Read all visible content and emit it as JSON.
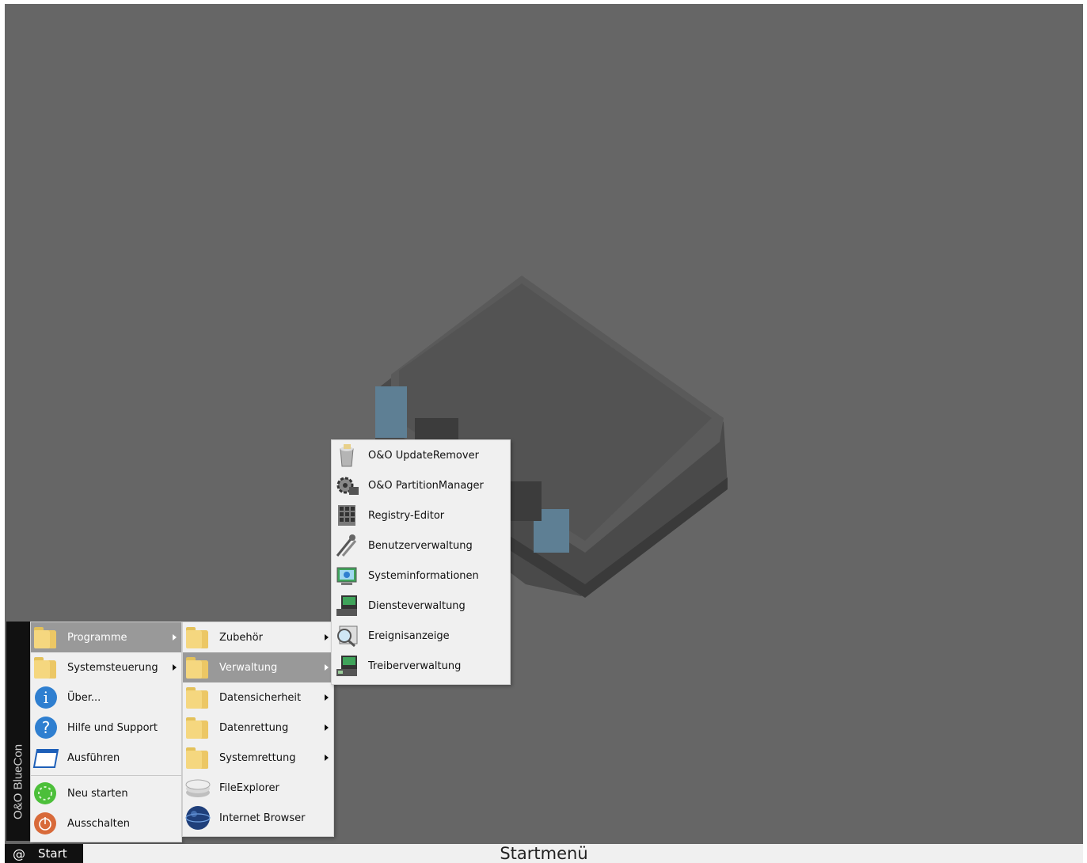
{
  "menu_main": {
    "items": [
      {
        "label": "Programme",
        "icon": "folder-icon"
      },
      {
        "label": "Systemsteuerung",
        "icon": "folder-icon"
      },
      {
        "label": "Über...",
        "icon": "info-icon"
      },
      {
        "label": "Hilfe und Support",
        "icon": "help-icon"
      },
      {
        "label": "Ausführen",
        "icon": "run-window-icon"
      },
      {
        "label": "Neu starten",
        "icon": "restart-icon"
      },
      {
        "label": "Ausschalten",
        "icon": "power-icon"
      }
    ]
  },
  "menu_programs": {
    "items": [
      {
        "label": "Zubehör",
        "icon": "folder-icon"
      },
      {
        "label": "Verwaltung",
        "icon": "folder-icon"
      },
      {
        "label": "Datensicherheit",
        "icon": "folder-icon"
      },
      {
        "label": "Datenrettung",
        "icon": "folder-icon"
      },
      {
        "label": "Systemrettung",
        "icon": "folder-icon"
      },
      {
        "label": "FileExplorer",
        "icon": "file-explorer-icon"
      },
      {
        "label": "Internet Browser",
        "icon": "globe-icon"
      }
    ]
  },
  "menu_admin": {
    "items": [
      {
        "label": "O&O UpdateRemover",
        "icon": "update-remover-icon"
      },
      {
        "label": "O&O PartitionManager",
        "icon": "partition-manager-icon"
      },
      {
        "label": "Registry-Editor",
        "icon": "registry-icon"
      },
      {
        "label": "Benutzerverwaltung",
        "icon": "users-keys-icon"
      },
      {
        "label": "Systeminformationen",
        "icon": "system-info-icon"
      },
      {
        "label": "Diensteverwaltung",
        "icon": "services-icon"
      },
      {
        "label": "Ereignisanzeige",
        "icon": "event-viewer-icon"
      },
      {
        "label": "Treiberverwaltung",
        "icon": "driver-icon"
      }
    ]
  },
  "sidebar": {
    "brand": "O&O BlueCon"
  },
  "taskbar": {
    "start_label": "Start",
    "start_icon": "at-icon",
    "caption": "Startmenü"
  },
  "colors": {
    "desktop": "#666666",
    "menu": "#f0f0f0",
    "highlight": "#999999",
    "sidebar": "#111111"
  }
}
